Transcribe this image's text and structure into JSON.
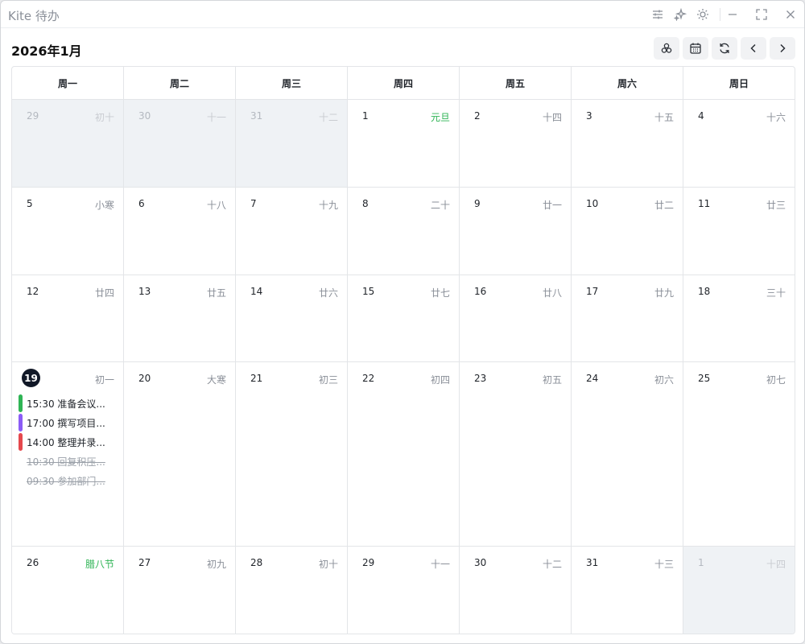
{
  "window": {
    "title": "Kite 待办"
  },
  "header": {
    "month_title": "2026年1月"
  },
  "weekdays": [
    "周一",
    "周二",
    "周三",
    "周四",
    "周五",
    "周六",
    "周日"
  ],
  "weeks": [
    [
      {
        "day": "29",
        "lunar": "初十",
        "other": true
      },
      {
        "day": "30",
        "lunar": "十一",
        "other": true
      },
      {
        "day": "31",
        "lunar": "十二",
        "other": true
      },
      {
        "day": "1",
        "lunar": "元旦",
        "festival": true
      },
      {
        "day": "2",
        "lunar": "十四"
      },
      {
        "day": "3",
        "lunar": "十五"
      },
      {
        "day": "4",
        "lunar": "十六"
      }
    ],
    [
      {
        "day": "5",
        "lunar": "小寒"
      },
      {
        "day": "6",
        "lunar": "十八"
      },
      {
        "day": "7",
        "lunar": "十九"
      },
      {
        "day": "8",
        "lunar": "二十"
      },
      {
        "day": "9",
        "lunar": "廿一"
      },
      {
        "day": "10",
        "lunar": "廿二"
      },
      {
        "day": "11",
        "lunar": "廿三"
      }
    ],
    [
      {
        "day": "12",
        "lunar": "廿四"
      },
      {
        "day": "13",
        "lunar": "廿五"
      },
      {
        "day": "14",
        "lunar": "廿六"
      },
      {
        "day": "15",
        "lunar": "廿七"
      },
      {
        "day": "16",
        "lunar": "廿八"
      },
      {
        "day": "17",
        "lunar": "廿九"
      },
      {
        "day": "18",
        "lunar": "三十"
      }
    ],
    [
      {
        "day": "19",
        "lunar": "初一",
        "today": true,
        "tasks": [
          {
            "text": "15:30 准备会议...",
            "color": "#2fb455",
            "done": false
          },
          {
            "text": "17:00 撰写项目...",
            "color": "#8b5cf6",
            "done": false
          },
          {
            "text": "14:00 整理并录...",
            "color": "#e5484d",
            "done": false
          },
          {
            "text": "10:30 回复积压...",
            "color": "",
            "done": true
          },
          {
            "text": "09:30 参加部门...",
            "color": "",
            "done": true
          }
        ]
      },
      {
        "day": "20",
        "lunar": "大寒"
      },
      {
        "day": "21",
        "lunar": "初三"
      },
      {
        "day": "22",
        "lunar": "初四"
      },
      {
        "day": "23",
        "lunar": "初五"
      },
      {
        "day": "24",
        "lunar": "初六"
      },
      {
        "day": "25",
        "lunar": "初七"
      }
    ],
    [
      {
        "day": "26",
        "lunar": "腊八节",
        "festival": true
      },
      {
        "day": "27",
        "lunar": "初九"
      },
      {
        "day": "28",
        "lunar": "初十"
      },
      {
        "day": "29",
        "lunar": "十一"
      },
      {
        "day": "30",
        "lunar": "十二"
      },
      {
        "day": "31",
        "lunar": "十三"
      },
      {
        "day": "1",
        "lunar": "十四",
        "other": true
      }
    ]
  ],
  "icons": {
    "titlebar": [
      "sliders-icon",
      "sparkle-icon",
      "sun-icon",
      "minimize-icon",
      "maximize-icon",
      "close-icon"
    ],
    "toolbar": [
      "layers-icon",
      "calendar-icon",
      "refresh-icon",
      "chevron-left-icon",
      "chevron-right-icon"
    ]
  },
  "colors": {
    "festival": "#2fb455",
    "today_badge": "#111827",
    "other_month_bg": "#eff2f5"
  }
}
